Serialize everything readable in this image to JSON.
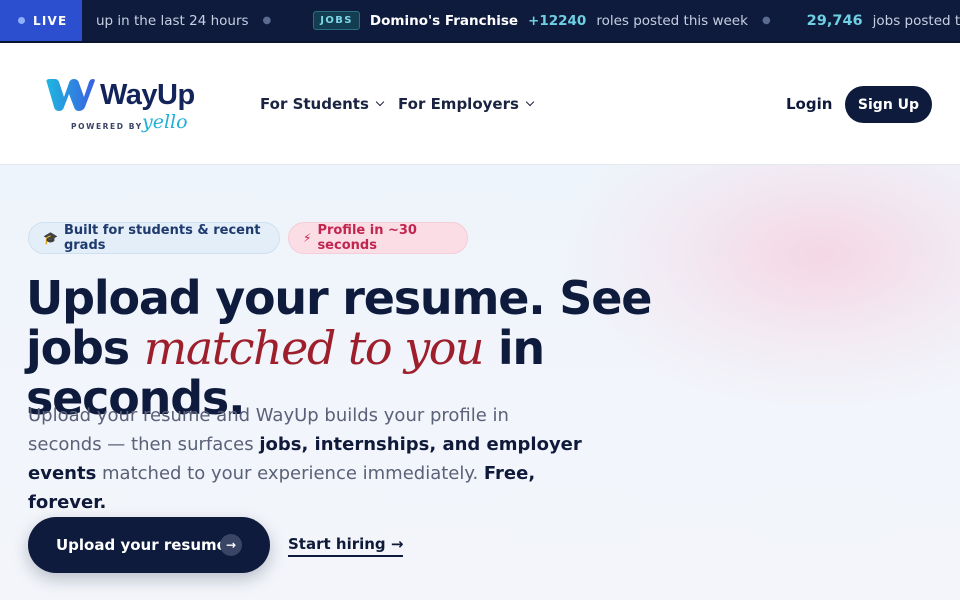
{
  "ticker": {
    "live_label": "LIVE",
    "items": {
      "prev_tail": "up in the last 24 hours",
      "badge": "JOBS",
      "company": "Domino's Franchise",
      "roles_count": "+12240",
      "roles_text": "roles posted this week",
      "jobs_count": "29,746",
      "jobs_text": "jobs posted this wee"
    }
  },
  "nav": {
    "brand": "WayUp",
    "powered_by": "POWERED BY",
    "partner": "yello",
    "links": [
      "For Students",
      "For Employers"
    ],
    "login": "Login",
    "signup": "Sign Up"
  },
  "hero": {
    "pills": {
      "students": "Built for students & recent grads",
      "students_icon": "🎓",
      "profile": "Profile in ~30 seconds",
      "profile_icon": "⚡"
    },
    "headline": {
      "line1": "Upload your resume. See",
      "prefix2": "jobs ",
      "accent": "matched to you",
      "suffix2": " in seconds."
    },
    "sub": {
      "part1": "Upload your resume and WayUp builds your profile in seconds — then surfaces ",
      "bold1": "jobs, internships, and employer events",
      "part2": " matched to your experience immediately. ",
      "bold2": "Free, forever."
    },
    "cta_label": "Upload your resume",
    "cta_icon": "→",
    "hire_label": "Start hiring →"
  },
  "colors": {
    "navy": "#0e1b3d",
    "accent_red": "#9e1f2c",
    "live_blue": "#2b4fcf",
    "cyan": "#6fd0e4"
  }
}
